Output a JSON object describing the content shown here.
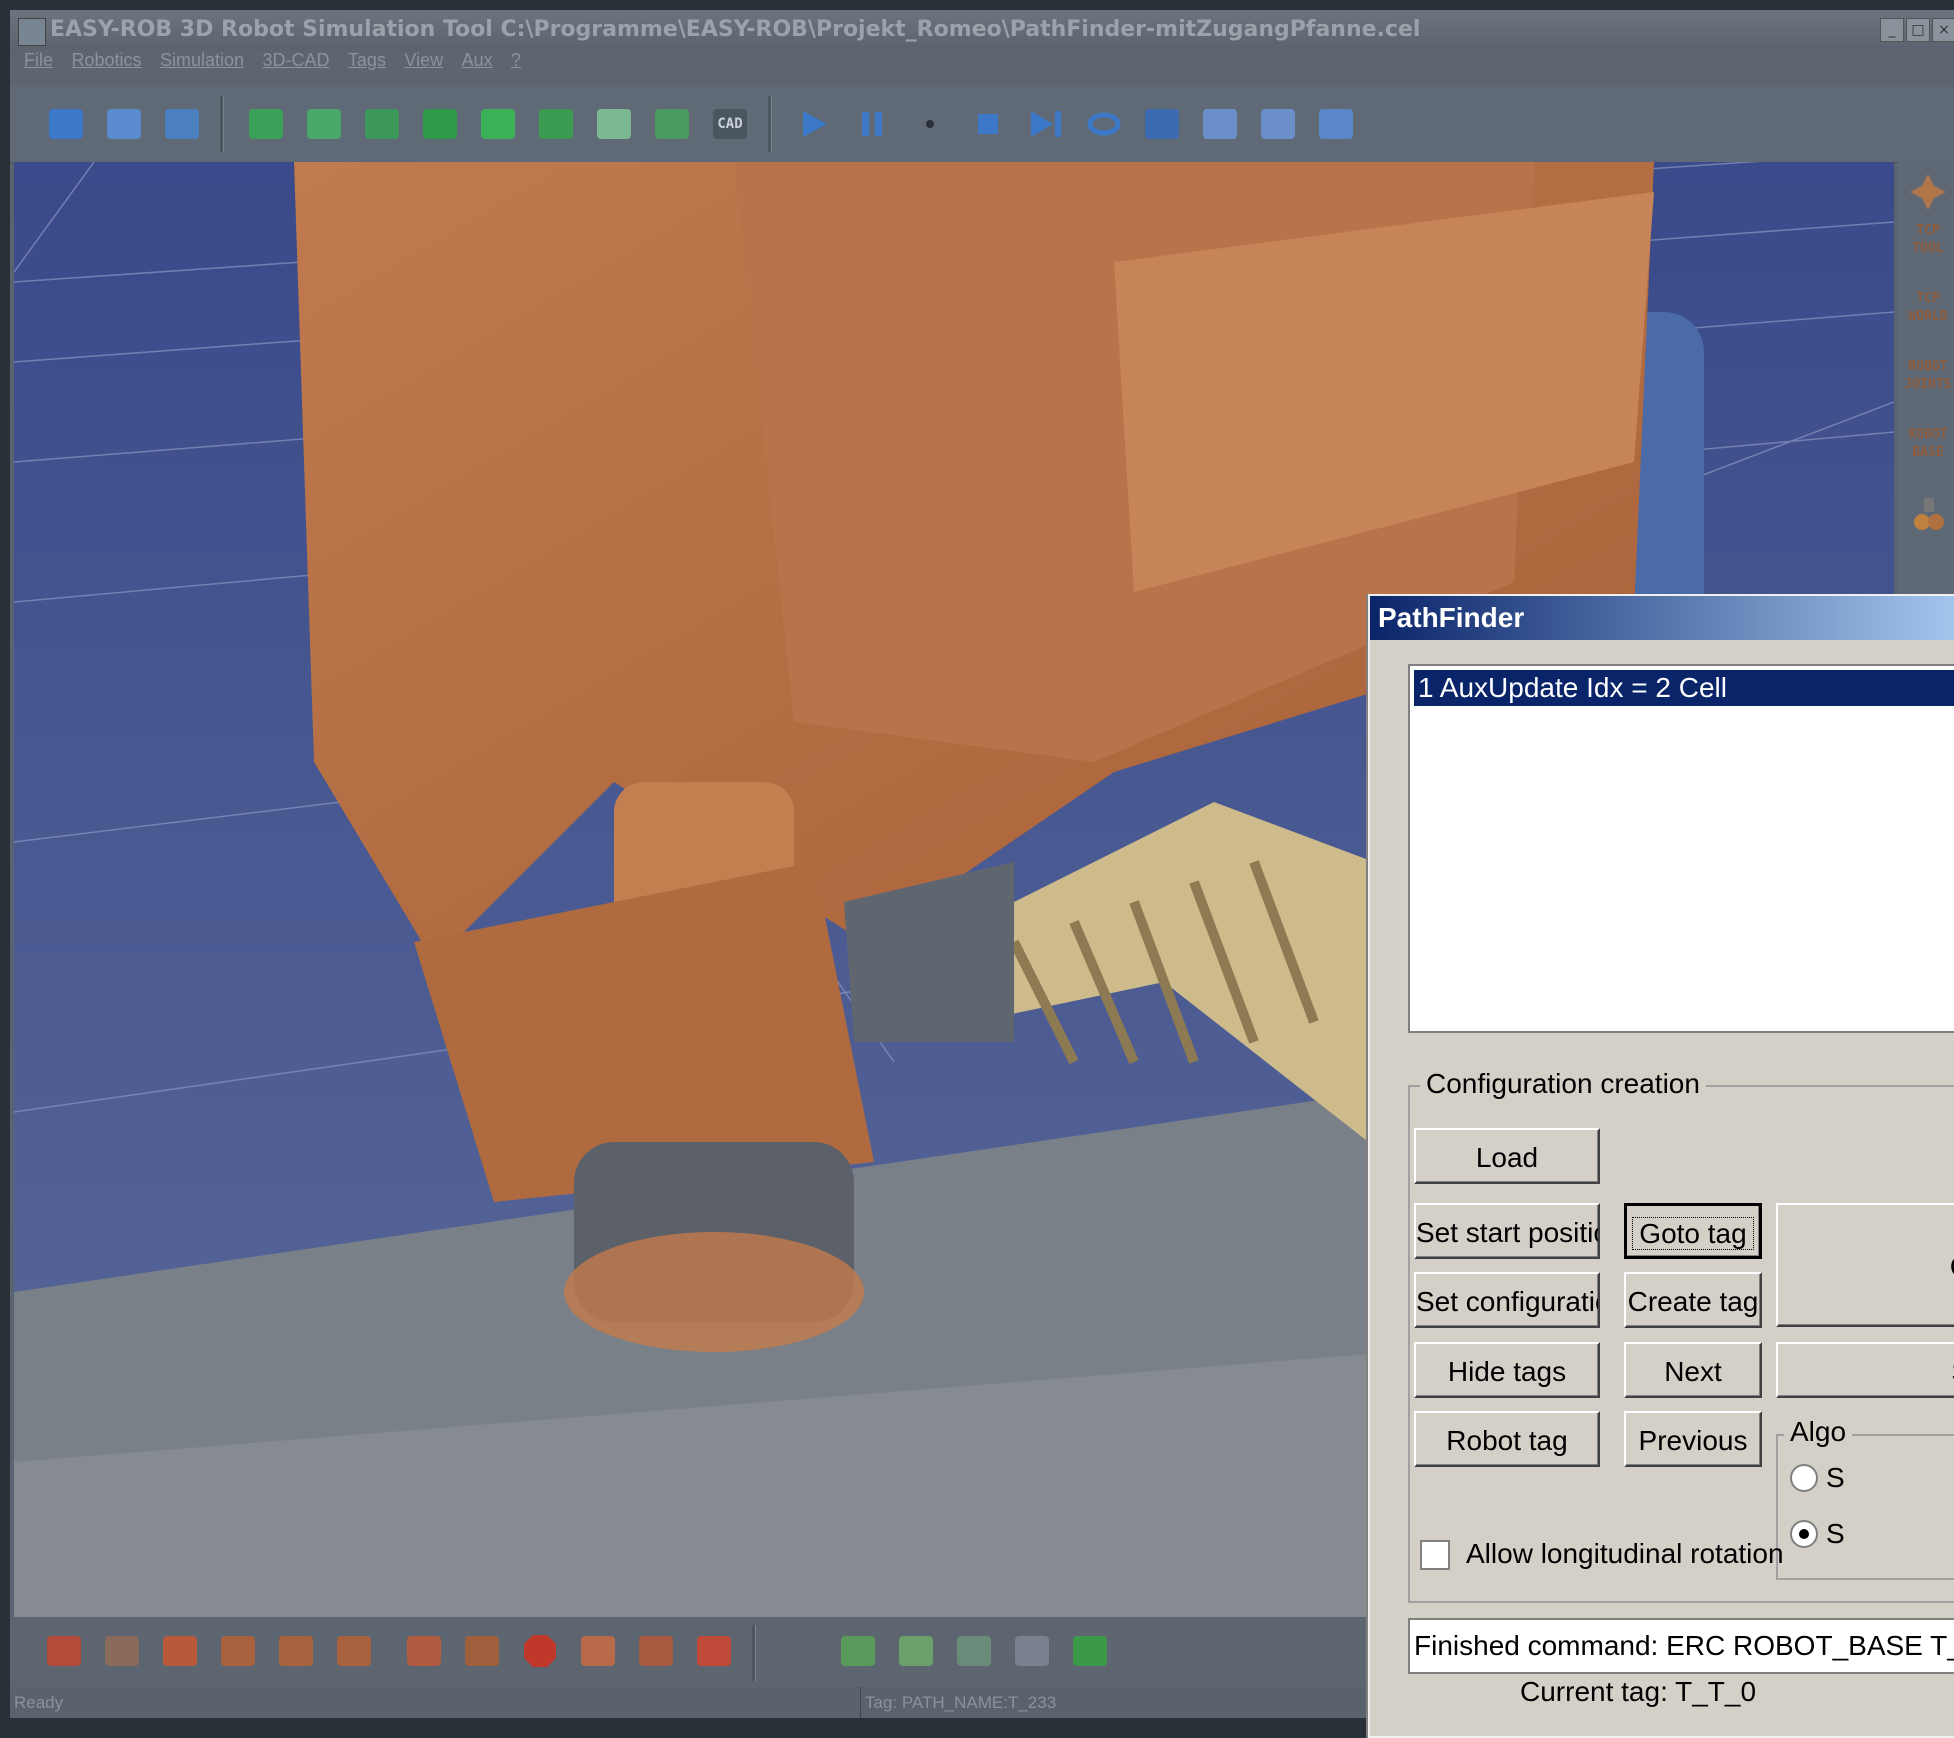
{
  "window": {
    "title": "EASY-ROB 3D Robot Simulation Tool  C:\\Programme\\EASY-ROB\\Projekt_Romeo\\PathFinder-mitZugangPfanne.cel",
    "minimize": "_",
    "maximize": "□",
    "close": "×"
  },
  "menu": {
    "items": [
      {
        "label": "File"
      },
      {
        "label": "Robotics"
      },
      {
        "label": "Simulation"
      },
      {
        "label": "3D-CAD"
      },
      {
        "label": "Tags"
      },
      {
        "label": "View"
      },
      {
        "label": "Aux"
      },
      {
        "label": "?"
      }
    ]
  },
  "toolbar": {
    "cad_label": "CAD",
    "colors": {
      "green": "#3aa05a",
      "blue": "#3b78c8",
      "accent": "#6a8fc8"
    }
  },
  "right_panel": {
    "items": [
      {
        "line1": "TCP",
        "line2": "TOOL"
      },
      {
        "line1": "TCP",
        "line2": "WORLD"
      },
      {
        "line1": "ROBOT",
        "line2": "JOINTS"
      },
      {
        "line1": "ROBOT",
        "line2": "BASE"
      }
    ]
  },
  "status_bar": {
    "ready": "Ready",
    "tag": "Tag: PATH_NAME:T_233"
  },
  "pathfinder": {
    "title": "PathFinder",
    "list_selected": "1 AuxUpdate Idx = 2 Cell",
    "config_group_label": "Configuration creation",
    "buttons": {
      "load": "Load",
      "set_start_position": "Set start position",
      "goto_tag": "Goto tag",
      "set_configuration": "Set configuration",
      "create_tag": "Create tag",
      "hide_tags": "Hide tags",
      "next": "Next",
      "robot_tag": "Robot tag",
      "previous": "Previous",
      "partial_right_1": "C",
      "partial_right_2": "S"
    },
    "algorithm_group_label": "Algo",
    "radio_1_label": "S",
    "radio_2_label": "S",
    "allow_longitudinal_rotation": "Allow longitudinal rotation",
    "status_text": "Finished command: ERC ROBOT_BASE T_",
    "bottom_partial": "Current tag:   T_T_0"
  }
}
